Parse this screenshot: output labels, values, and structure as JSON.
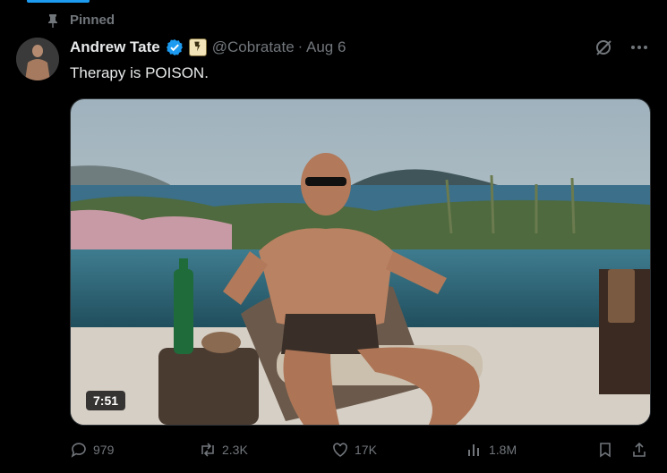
{
  "pinned_label": "Pinned",
  "author": {
    "name": "Andrew Tate",
    "handle": "@Cobratate",
    "date": "Aug 6"
  },
  "tweet": {
    "text": "Therapy is POISON."
  },
  "video": {
    "duration": "7:51"
  },
  "actions": {
    "replies": "979",
    "reposts": "2.3K",
    "likes": "17K",
    "views": "1.8M"
  },
  "icons": {
    "pin": "pin-icon",
    "verified": "verified-badge-icon",
    "affiliate": "affiliate-badge-icon",
    "grok": "grok-icon",
    "more": "more-icon",
    "reply": "reply-icon",
    "repost": "repost-icon",
    "like": "heart-icon",
    "views": "views-icon",
    "bookmark": "bookmark-icon",
    "share": "share-icon"
  },
  "colors": {
    "accent": "#1d9bf0",
    "muted": "#71767b",
    "text": "#e7e9ea",
    "background": "#000000"
  }
}
